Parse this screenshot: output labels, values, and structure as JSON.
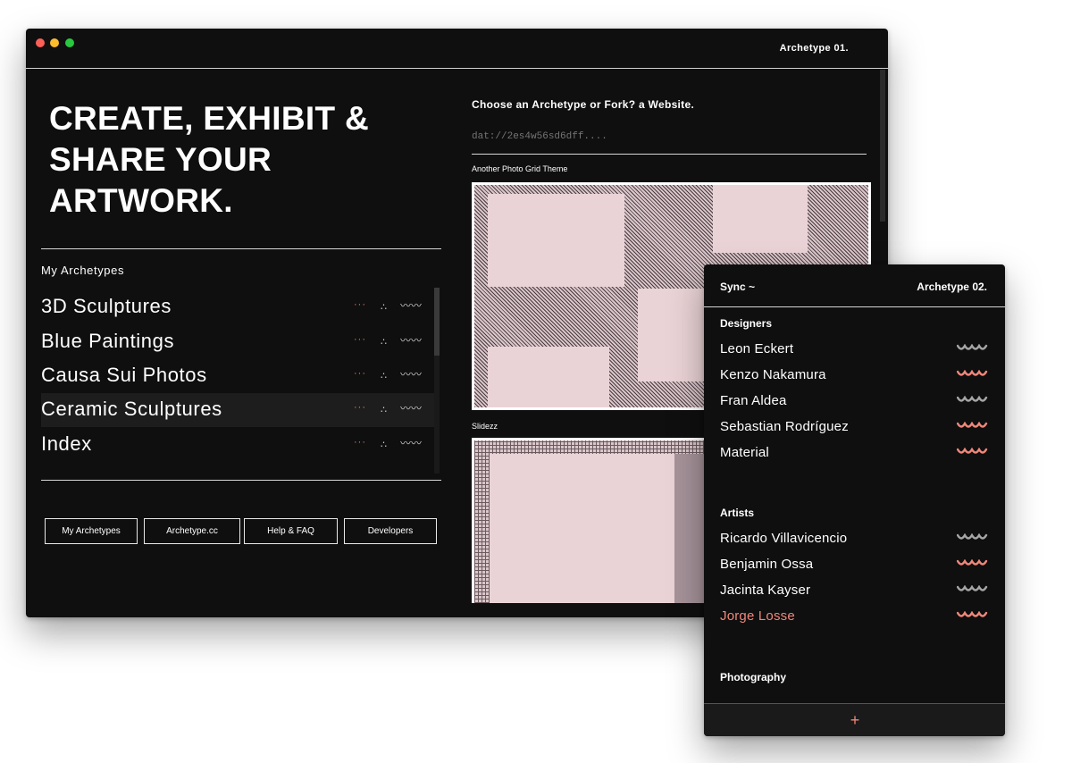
{
  "window1": {
    "title": "Archetype 01.",
    "hero_line1": "CREATE, EXHIBIT &",
    "hero_line2": "SHARE YOUR",
    "hero_line3": "ARTWORK.",
    "my_archetypes_label": "My Archetypes",
    "archetypes": [
      {
        "label": "3D Sculptures"
      },
      {
        "label": "Blue Paintings"
      },
      {
        "label": "Causa Sui Photos"
      },
      {
        "label": "Ceramic Sculptures",
        "selected": true
      },
      {
        "label": "Index"
      }
    ],
    "nav_buttons": [
      "My Archetypes",
      "Archetype.cc",
      "Help & FAQ",
      "Developers"
    ],
    "choose_title": "Choose an Archetype or Fork? a Website.",
    "dat_placeholder": "dat://2es4w56sd6dff....",
    "themes": [
      "Another Photo Grid Theme",
      "Slidezz"
    ]
  },
  "window2": {
    "sync_label": "Sync ~",
    "title": "Archetype 02.",
    "groups": [
      {
        "title": "Designers",
        "members": [
          {
            "name": "Leon Eckert",
            "status_color": "#a6a6a6"
          },
          {
            "name": "Kenzo Nakamura",
            "status_color": "#f0877a"
          },
          {
            "name": "Fran Aldea",
            "status_color": "#a6a6a6"
          },
          {
            "name": "Sebastian Rodríguez",
            "status_color": "#f0877a"
          },
          {
            "name": "Material",
            "status_color": "#f0877a"
          }
        ]
      },
      {
        "title": "Artists",
        "members": [
          {
            "name": "Ricardo Villavicencio",
            "status_color": "#a6a6a6"
          },
          {
            "name": "Benjamin Ossa",
            "status_color": "#f0877a"
          },
          {
            "name": "Jacinta Kayser",
            "status_color": "#a6a6a6"
          },
          {
            "name": "Jorge Losse",
            "status_color": "#f0877a",
            "highlighted": true
          }
        ]
      },
      {
        "title": "Photography",
        "members": []
      }
    ],
    "add_symbol": "+"
  },
  "colors": {
    "window_bg": "#0f0f0f",
    "accent": "#f0877a",
    "thumb_pink": "#ead3d6",
    "muted": "#a6a6a6"
  },
  "icons": [
    "close-dot",
    "minimize-dot",
    "zoom-dot",
    "dots-icon",
    "triangle-dots-icon",
    "squiggle-icon",
    "wave-status-icon",
    "plus-icon"
  ]
}
